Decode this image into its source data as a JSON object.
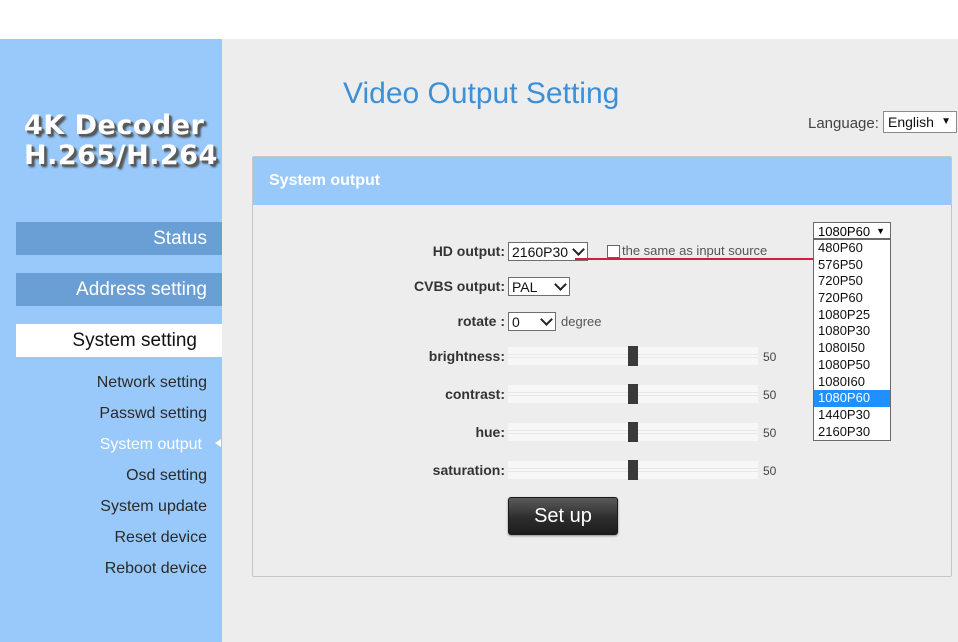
{
  "logo": {
    "line1": "4K Decoder",
    "line2": "H.265/H.264"
  },
  "nav": {
    "main": [
      "Status",
      "Address setting",
      "System setting"
    ],
    "sub": [
      "Network setting",
      "Passwd setting",
      "System output",
      "Osd setting",
      "System update",
      "Reset device",
      "Reboot device"
    ],
    "active_main": "System setting",
    "active_sub": "System output"
  },
  "header": {
    "title": "Video Output Setting"
  },
  "language": {
    "label": "Language:",
    "value": "English"
  },
  "panel": {
    "title": "System output"
  },
  "form": {
    "hd_output": {
      "label": "HD output:",
      "value": "2160P30"
    },
    "same_as_source": {
      "label": "the same as input source",
      "checked": false
    },
    "cvbs_output": {
      "label": "CVBS output:",
      "value": "PAL"
    },
    "rotate": {
      "label": "rotate :",
      "value": "0",
      "unit": "degree"
    },
    "brightness": {
      "label": "brightness:",
      "value": "50",
      "level": 0.5
    },
    "contrast": {
      "label": "contrast:",
      "value": "50",
      "level": 0.5
    },
    "hue": {
      "label": "hue:",
      "value": "50",
      "level": 0.5
    },
    "saturation": {
      "label": "saturation:",
      "value": "50",
      "level": 0.5
    },
    "setup_label": "Set up"
  },
  "dropdown": {
    "current": "1080P60",
    "options": [
      "480P60",
      "576P50",
      "720P50",
      "720P60",
      "1080P25",
      "1080P30",
      "1080I50",
      "1080P50",
      "1080I60",
      "1080P60",
      "1440P30",
      "2160P30"
    ],
    "highlighted": "1080P60"
  },
  "colors": {
    "sidebar": "#99c9fa",
    "title": "#3d8fd6",
    "annotation_line": "#d81b3a",
    "highlight": "#1e90ff"
  }
}
